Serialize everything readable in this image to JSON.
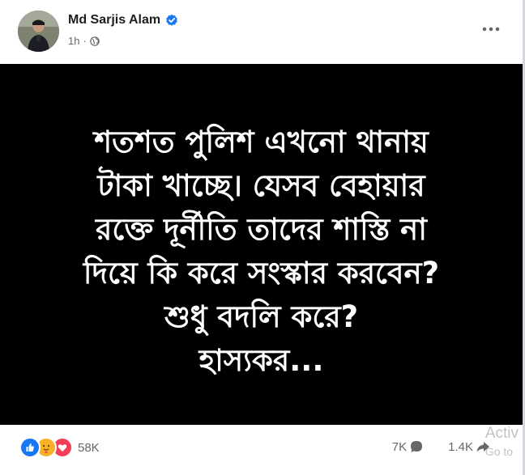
{
  "post": {
    "author": "Md Sarjis Alam",
    "time": "1h",
    "text_lines": [
      "শতশত পুলিশ এখনো থানায়",
      "টাকা খাচ্ছে। যেসব বেহায়ার",
      "রক্তে দূর্নীতি তাদের শাস্তি না",
      "দিয়ে কি করে সংস্কার করবেন?",
      "শুধু বদলি করে?",
      "হাস্যকর..."
    ]
  },
  "footer": {
    "reaction_count": "58K",
    "comments_count": "7K",
    "shares_count": "1.4K"
  },
  "watermark": {
    "line1": "Activ",
    "line2": "Go to"
  },
  "icons": {
    "verified": "verified-badge-icon",
    "globe": "globe-icon",
    "more": "more-options-icon",
    "like": "like-icon",
    "care": "care-icon",
    "love": "love-icon",
    "comment": "comment-icon",
    "share": "share-icon"
  },
  "colors": {
    "verified_blue": "#1877f2",
    "like_blue": "#1877f2",
    "love_red": "#f33e58",
    "care_yellow": "#f7b125",
    "secondary_text": "#65676b",
    "image_bg": "#000000"
  }
}
